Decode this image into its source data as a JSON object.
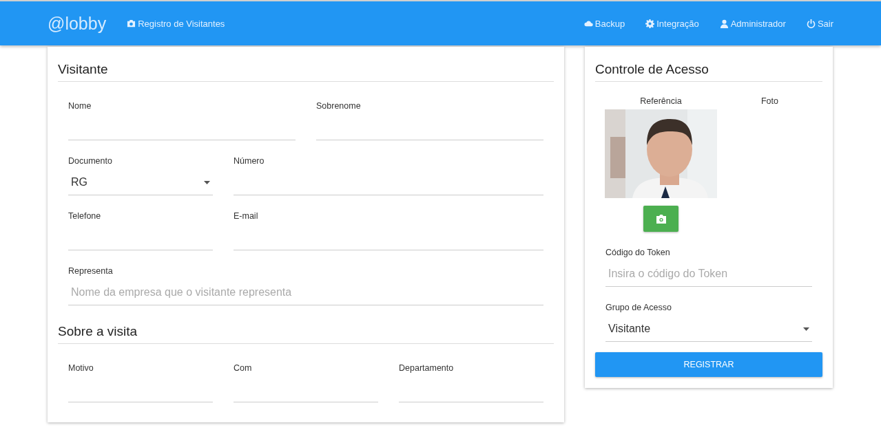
{
  "navbar": {
    "brand": "@lobby",
    "left_links": [
      {
        "kind": "camera",
        "label": "Registro de Visitantes"
      }
    ],
    "right_links": [
      {
        "kind": "cloud",
        "label": "Backup"
      },
      {
        "kind": "gear",
        "label": "Integração"
      },
      {
        "kind": "user",
        "label": "Administrador"
      },
      {
        "kind": "power",
        "label": "Sair"
      }
    ]
  },
  "visitor_card": {
    "sections": [
      {
        "title": "Visitante",
        "rows": [
          [
            {
              "label": "Nome",
              "kind": "text"
            },
            {
              "label": "Sobrenome",
              "kind": "text"
            }
          ],
          [
            {
              "label": "Documento",
              "kind": "select",
              "value": "RG"
            },
            {
              "label": "Número",
              "kind": "text"
            }
          ],
          [
            {
              "label": "Telefone",
              "kind": "text"
            },
            {
              "label": "E-mail",
              "kind": "text"
            }
          ],
          [
            {
              "label": "Representa",
              "kind": "text",
              "placeholder": "Nome da empresa que o visitante representa"
            }
          ]
        ]
      },
      {
        "title": "Sobre a visita",
        "rows": [
          [
            {
              "label": "Motivo",
              "kind": "text"
            },
            {
              "label": "Com",
              "kind": "text"
            },
            {
              "label": "Departamento",
              "kind": "text"
            }
          ]
        ]
      }
    ]
  },
  "access_card": {
    "title": "Controle de Acesso",
    "photo_labels": [
      "Referência",
      "Foto"
    ],
    "reference_photo": {
      "kind": "picture"
    },
    "fields": [
      {
        "label": "Código do Token",
        "kind": "text",
        "placeholder": "Insira o código do Token"
      },
      {
        "label": "Grupo de Acesso",
        "kind": "select",
        "value": "Visitante"
      }
    ],
    "submit": "REGISTRAR"
  }
}
